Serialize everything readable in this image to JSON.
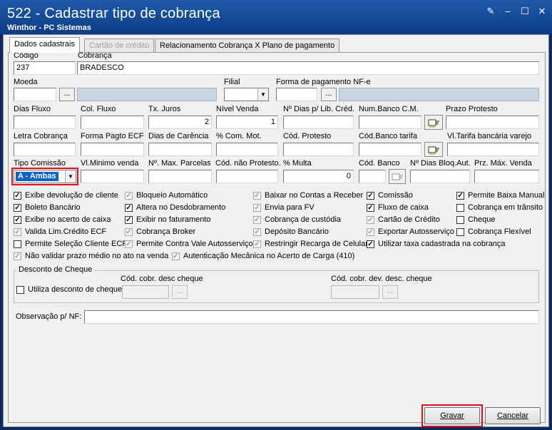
{
  "window": {
    "title": "522 - Cadastrar tipo de cobrança",
    "subtitle": "Winthor - PC Sistemas",
    "buttons": [
      "✎",
      "–",
      "☐",
      "✕"
    ]
  },
  "tabs": [
    {
      "label": "Dados cadastrais",
      "state": "active"
    },
    {
      "label": "Cartão de crédito",
      "state": "disabled"
    },
    {
      "label": "Relacionamento Cobrança X Plano de pagamento",
      "state": "normal"
    }
  ],
  "fields": {
    "codigo": {
      "label": "Código",
      "value": "237"
    },
    "cobranca": {
      "label": "Cobrança",
      "value": "BRADESCO"
    },
    "moeda": {
      "label": "Moeda",
      "value": ""
    },
    "filial": {
      "label": "Filial",
      "value": ""
    },
    "forma_pag_nfe": {
      "label": "Forma de pagamento NF-e",
      "value": ""
    },
    "dias_fluxo": {
      "label": "Dias Fluxo",
      "value": ""
    },
    "col_fluxo": {
      "label": "Col. Fluxo",
      "value": ""
    },
    "tx_juros": {
      "label": "Tx. Juros",
      "value": "2"
    },
    "nivel_venda": {
      "label": "Nível Venda",
      "value": "1"
    },
    "dias_lib_cred": {
      "label": "Nº Dias p/ Lib. Créd.",
      "value": ""
    },
    "num_banco_cm": {
      "label": "Num.Banco C.M.",
      "value": ""
    },
    "prazo_protesto": {
      "label": "Prazo Protesto",
      "value": ""
    },
    "letra_cobranca": {
      "label": "Letra Cobrança",
      "value": ""
    },
    "forma_pagto_ecf": {
      "label": "Forma Pagto ECF",
      "value": ""
    },
    "dias_carencia": {
      "label": "Dias de Carência",
      "value": ""
    },
    "com_mot": {
      "label": "% Com. Mot.",
      "value": ""
    },
    "cod_protesto": {
      "label": "Cód. Protesto",
      "value": ""
    },
    "cod_banco_tarifa": {
      "label": "Cód.Banco tarifa",
      "value": ""
    },
    "vl_tarifa": {
      "label": "Vl.Tarifa bancária varejo",
      "value": ""
    },
    "tipo_comissao": {
      "label": "Tipo Comissão",
      "value": "A - Ambas"
    },
    "vl_minimo_venda": {
      "label": "Vl.Minimo venda",
      "value": ""
    },
    "max_parcelas": {
      "label": "Nº. Max. Parcelas",
      "value": ""
    },
    "cod_nao_protesto": {
      "label": "Cód. não Protesto.",
      "value": ""
    },
    "multa": {
      "label": "% Multa",
      "value": "0"
    },
    "cod_banco": {
      "label": "Cód. Banco",
      "value": ""
    },
    "dias_bloq_aut": {
      "label": "Nº Dias Bloq.Aut.",
      "value": ""
    },
    "prz_max_venda": {
      "label": "Prz. Máx. Venda",
      "value": ""
    }
  },
  "ellipsis": "...",
  "checkboxes": [
    {
      "label": "Exibe devolução de cliente",
      "checked": true,
      "disabled": false
    },
    {
      "label": "Boleto Bancário",
      "checked": true,
      "disabled": false
    },
    {
      "label": "Exibe no acerto de caixa",
      "checked": true,
      "disabled": false
    },
    {
      "label": "Valida Lim.Crédito ECF",
      "checked": true,
      "disabled": true
    },
    {
      "label": "Permite Seleção Cliente ECF",
      "checked": false,
      "disabled": false
    },
    {
      "label": "Não validar prazo médio no ato na venda",
      "checked": true,
      "disabled": true
    },
    {
      "label": "Bloqueio Automático",
      "checked": true,
      "disabled": true
    },
    {
      "label": "Altera no Desdobramento",
      "checked": true,
      "disabled": false
    },
    {
      "label": "Exibir no faturamento",
      "checked": true,
      "disabled": false
    },
    {
      "label": "Cobrança Broker",
      "checked": true,
      "disabled": true
    },
    {
      "label": "Permite Contra Vale Autosserviço",
      "checked": true,
      "disabled": true
    },
    {
      "label": "Autenticação Mecânica no Acerto de Carga (410)",
      "checked": true,
      "disabled": true
    },
    {
      "label": "Baixar no Contas a Receber",
      "checked": true,
      "disabled": true
    },
    {
      "label": "Envia para FV",
      "checked": true,
      "disabled": true
    },
    {
      "label": "Cobrança de custódia",
      "checked": true,
      "disabled": true
    },
    {
      "label": "Depósito Bancário",
      "checked": true,
      "disabled": true
    },
    {
      "label": "Restringir Recarga de Celular",
      "checked": true,
      "disabled": true
    },
    {
      "label": "Comissão",
      "checked": true,
      "disabled": false
    },
    {
      "label": "Fluxo de caixa",
      "checked": true,
      "disabled": false
    },
    {
      "label": "Cartão de Crédito",
      "checked": true,
      "disabled": true
    },
    {
      "label": "Exportar Autosserviço",
      "checked": true,
      "disabled": true
    },
    {
      "label": "Utilizar taxa cadastrada na cobrança",
      "checked": true,
      "disabled": false
    },
    {
      "label": "Permite Baixa Manual",
      "checked": true,
      "disabled": false
    },
    {
      "label": "Cobrança em trânsito",
      "checked": false,
      "disabled": false
    },
    {
      "label": "Cheque",
      "checked": false,
      "disabled": false
    },
    {
      "label": "Cobrança Flexível",
      "checked": false,
      "disabled": false
    }
  ],
  "desconto_cheque": {
    "title": "Desconto de Cheque",
    "utiliza_label": "Utiliza desconto de cheque",
    "utiliza_checked": false,
    "cod_desc_label": "Cód. cobr. desc cheque",
    "cod_dev_label": "Cód. cobr. dev. desc. cheque"
  },
  "observacao": {
    "label": "Observação p/ NF:",
    "value": ""
  },
  "actions": {
    "gravar": "Gravar",
    "cancelar": "Cancelar"
  },
  "colors": {
    "highlight": "#e0101a",
    "selection": "#0a63c9",
    "titlebar": "#0c3d86"
  }
}
